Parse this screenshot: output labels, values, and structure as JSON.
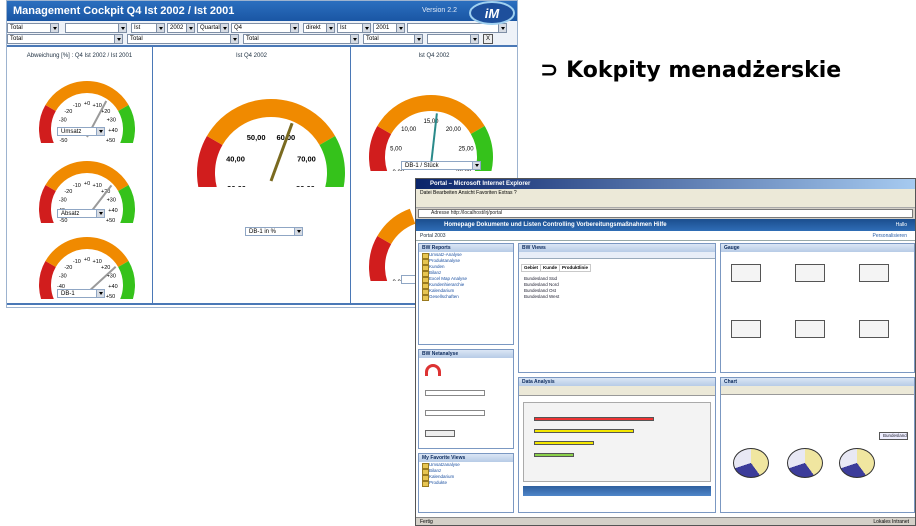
{
  "heading": {
    "bullet": "⊃",
    "text": "Kokpity menadżerskie"
  },
  "cockpit": {
    "title": "Management Cockpit Q4  Ist 2002 / Ist 2001",
    "version": "Version 2.2",
    "logo_text": "iM",
    "filters_row1": [
      "Total",
      "",
      "Ist",
      "2002",
      "Quartal",
      "Q4",
      "direkt",
      "Ist",
      "2001",
      ""
    ],
    "filters_row2": [
      "Total",
      "Total",
      "Total",
      "Total",
      ""
    ],
    "close_button": "X",
    "panels": [
      {
        "title": "Abweichung [%] : Q4  Ist 2002 / Ist 2001"
      },
      {
        "title": "Ist Q4 2002"
      },
      {
        "title": "Ist Q4 2002"
      }
    ],
    "gauges": [
      {
        "label": "Umsatz",
        "ticks": [
          "-50",
          "-40",
          "-30",
          "-20",
          "-10",
          "+0",
          "+10",
          "+20",
          "+30",
          "+40",
          "+50"
        ],
        "value": 15
      },
      {
        "label": "Absatz",
        "ticks": [
          "-50",
          "-40",
          "-30",
          "-20",
          "-10",
          "+0",
          "+10",
          "+20",
          "+30",
          "+40",
          "+50"
        ],
        "value": 20
      },
      {
        "label": "DB-1",
        "ticks": [
          "-50",
          "-40",
          "-30",
          "-20",
          "-10",
          "+0",
          "+10",
          "+20",
          "+30",
          "+40",
          "+50"
        ],
        "value": 25
      },
      {
        "label": "DB-1 in %",
        "ticks": [
          "30,00",
          "40,00",
          "50,00",
          "60,00",
          "70,00",
          "80,00"
        ],
        "value": 60
      },
      {
        "label": "DB-1 / Stück",
        "ticks": [
          "0,00",
          "5,00",
          "10,00",
          "15,00",
          "20,00",
          "25,00",
          "30,00"
        ],
        "value": 16
      },
      {
        "label": "",
        "ticks": [
          "0,00"
        ],
        "value": 0
      }
    ]
  },
  "portal": {
    "title": "Portal – Microsoft Internet Explorer",
    "menu": "Datei   Bearbeiten   Ansicht   Favoriten   Extras   ?",
    "address": "Adresse   http://localhost/irj/portal",
    "navbar": "Homepage   Dokumente und Listen   Controlling   Vorbereitungsmaßnahmen   Hilfe",
    "navbar_right": "Hallo",
    "crumbs": "Portal 2003",
    "crumbs_right": "Personalisieren",
    "status_left": "Fertig",
    "status_right": "Lokales Intranet",
    "left_pane_title": "BW Reports",
    "left_links": [
      "Umsatz-Analyse",
      "Produktanalyse",
      "Kunden",
      "Bilanz",
      "Excel Map Analyse",
      "Kundenhierarchie",
      "Kalendarium",
      "Gesellschaften"
    ],
    "left_pane2_title": "BW Netanalyse",
    "left_pane3_title": "My Favorite Views",
    "fav_links": [
      "Umsatzanalyse",
      "Bilanz",
      "Kalendarium",
      "Produkte"
    ],
    "mid_pane_title": "BW Views",
    "mid_table_header": [
      "Gebiet",
      "Kunde",
      "Produktlinie"
    ],
    "mid_rows": [
      "Bundesland Süd",
      "Bundesland Nord",
      "Bundesland Ost",
      "Bundesland West"
    ],
    "mid_pane2_title": "Data Analysis",
    "top_right_title": "Gauge",
    "bottom_right_title": "Chart",
    "chart_legend": [
      "Bundesland"
    ]
  }
}
